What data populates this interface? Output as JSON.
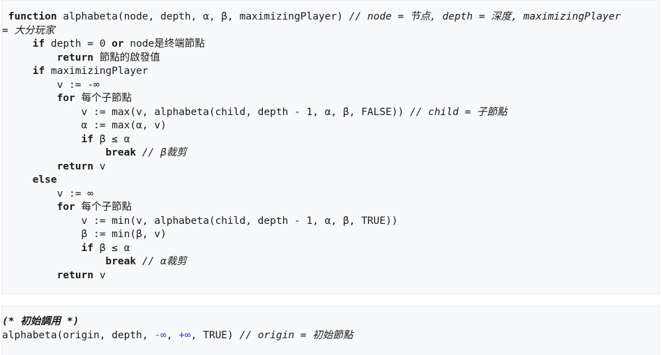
{
  "block1": {
    "l1": {
      "kw": "function",
      "code": " alphabeta(node, depth, α, β, maximizingPlayer) ",
      "comment": "// node = 节点, depth = 深度, maximizingPlayer"
    },
    "l2": {
      "comment": "= 大分玩家"
    },
    "l3": {
      "kw1": "if",
      "code1": " depth = 0 ",
      "kw2": "or",
      "code2": " node是终端節點"
    },
    "l4": {
      "kw": "return",
      "code": " 節點的啟發值"
    },
    "l5": {
      "kw": "if",
      "code": " maximizingPlayer"
    },
    "l6": {
      "code": "v := -∞"
    },
    "l7": {
      "kw": "for",
      "code": " 每个子節點"
    },
    "l8": {
      "code": "v := max(v, alphabeta(child, depth - 1, α, β, FALSE)) ",
      "comment": "// child = 子節點"
    },
    "l9": {
      "code": "α := max(α, v)"
    },
    "l10": {
      "kw": "if",
      "code": " β ≤ α"
    },
    "l11": {
      "kw": "break",
      "comment": " // β裁剪"
    },
    "l12": {
      "kw": "return",
      "code": " v"
    },
    "l13": {
      "kw": "else"
    },
    "l14": {
      "code": "v := ∞"
    },
    "l15": {
      "kw": "for",
      "code": " 每个子節點"
    },
    "l16": {
      "code": "v := min(v, alphabeta(child, depth - 1, α, β, TRUE))"
    },
    "l17": {
      "code": "β := min(β, v)"
    },
    "l18": {
      "kw": "if",
      "code": " β ≤ α"
    },
    "l19": {
      "kw": "break",
      "comment": " // α裁剪"
    },
    "l20": {
      "kw": "return",
      "code": " v"
    }
  },
  "block2": {
    "l1": {
      "comment": "(* 初始調用 *)"
    },
    "l2": {
      "code1": "alphabeta(origin, depth, ",
      "neg_inf": "-∞",
      "sep": ", ",
      "pos_inf": "+∞",
      "code2": ", TRUE) ",
      "comment": "// origin = 初始節點"
    }
  }
}
